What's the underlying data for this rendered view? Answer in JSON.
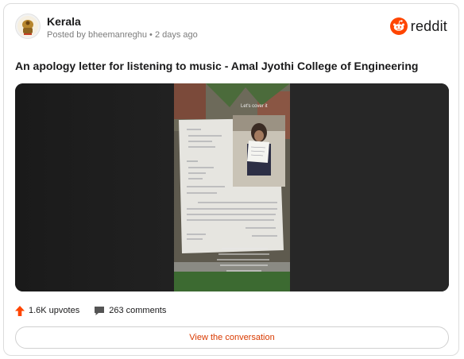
{
  "post": {
    "subreddit": "Kerala",
    "meta": "Posted by bheemanreghu • 2 days ago",
    "title": "An apology letter for listening to music - Amal Jyothi College of Engineering",
    "video_overlay_label": "Let's cover it",
    "upvotes": "1.6K upvotes",
    "comments": "263 comments",
    "view_conversation": "View the conversation"
  },
  "brand": {
    "name": "reddit",
    "color": "#ff4500"
  },
  "icons": {
    "subreddit": "kerala-emblem-icon",
    "brand": "reddit-alien-icon",
    "upvote": "upvote-arrow-icon",
    "comment": "comment-bubble-icon"
  },
  "colors": {
    "upvote": "#ff4500",
    "link": "#d93a00",
    "text": "#1a1a1b",
    "muted": "#7c7c7c"
  }
}
